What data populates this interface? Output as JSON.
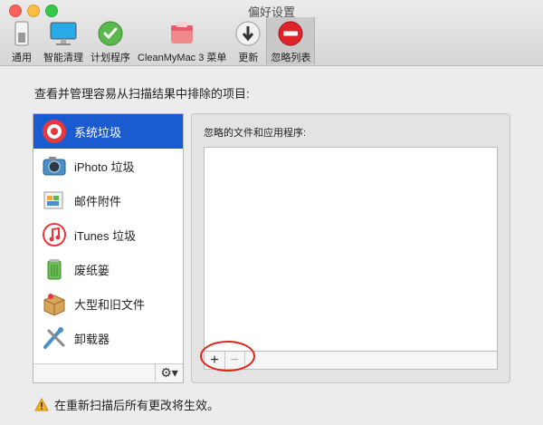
{
  "window": {
    "title": "偏好设置",
    "traffic_lights": {
      "close": "#fc605b",
      "minimize": "#fdbc40",
      "zoom": "#34c84a"
    }
  },
  "toolbar": {
    "tabs": [
      {
        "label": "通用",
        "icon": "switch-icon"
      },
      {
        "label": "智能清理",
        "icon": "monitor-icon"
      },
      {
        "label": "计划程序",
        "icon": "clock-icon"
      },
      {
        "label": "CleanMyMac 3 菜单",
        "icon": "menu-icon"
      },
      {
        "label": "更新",
        "icon": "download-icon"
      },
      {
        "label": "忽略列表",
        "icon": "no-entry-icon",
        "active": true
      }
    ]
  },
  "main": {
    "heading": "查看并管理容易从扫描结果中排除的项目:",
    "categories": [
      {
        "label": "系统垃圾",
        "icon": "system-junk-icon",
        "selected": true
      },
      {
        "label": "iPhoto 垃圾",
        "icon": "iphoto-icon"
      },
      {
        "label": "邮件附件",
        "icon": "mail-attachment-icon"
      },
      {
        "label": "iTunes 垃圾",
        "icon": "itunes-icon"
      },
      {
        "label": "废纸篓",
        "icon": "trash-icon"
      },
      {
        "label": "大型和旧文件",
        "icon": "box-icon"
      },
      {
        "label": "卸载器",
        "icon": "uninstaller-icon"
      }
    ],
    "gear_menu": "⚙▾",
    "panel_label": "忽略的文件和应用程序:",
    "add_label": "+",
    "remove_label": "−",
    "warning": "在重新扫描后所有更改将生效。"
  },
  "colors": {
    "selection": "#1a5bd0",
    "highlight_circle": "#e2231a"
  }
}
